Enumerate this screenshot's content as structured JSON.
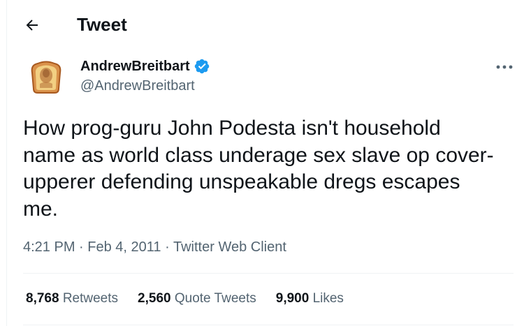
{
  "header": {
    "title": "Tweet"
  },
  "tweet": {
    "author": {
      "name": "AndrewBreitbart",
      "handle": "@AndrewBreitbart",
      "verified": true
    },
    "text": "How prog-guru John Podesta isn't household\nname as world class underage sex slave op cover-\nupperer defending unspeakable dregs escapes\nme.",
    "time": "4:21 PM",
    "date": "Feb 4, 2011",
    "separator": "·",
    "client": "Twitter Web Client",
    "stats": {
      "retweets": {
        "count": "8,768",
        "label": "Retweets"
      },
      "quote_tweets": {
        "count": "2,560",
        "label": "Quote Tweets"
      },
      "likes": {
        "count": "9,900",
        "label": "Likes"
      }
    }
  },
  "icons": {
    "back": "arrow-left-icon",
    "verified": "verified-badge-icon",
    "more": "more-horizontal-icon"
  },
  "colors": {
    "text": "#0f1419",
    "secondary": "#536471",
    "verified": "#1d9bf0",
    "divider": "#eff3f4"
  }
}
